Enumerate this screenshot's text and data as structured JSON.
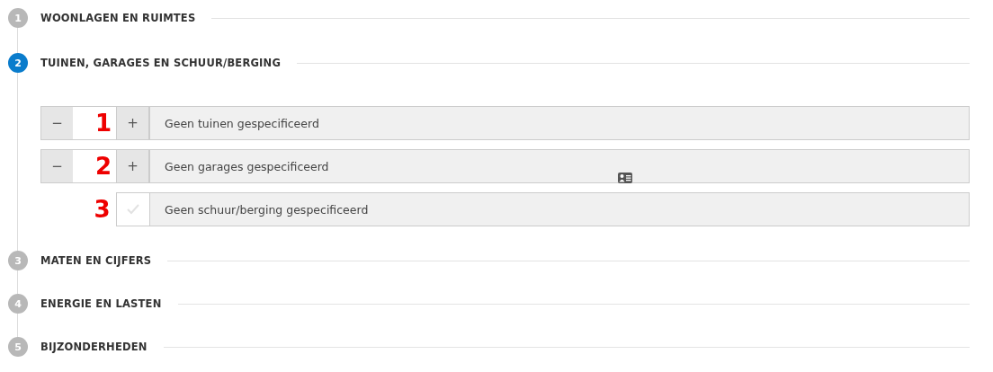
{
  "steps": [
    {
      "number": "1",
      "title": "WOONLAGEN EN RUIMTES",
      "selected": false
    },
    {
      "number": "2",
      "title": "TUINEN, GARAGES EN SCHUUR/BERGING",
      "selected": true,
      "items": [
        {
          "kind": "counter",
          "minus": "−",
          "annotation": "1",
          "plus": "+",
          "label": "Geen tuinen gespecificeerd"
        },
        {
          "kind": "counter",
          "minus": "−",
          "annotation": "2",
          "plus": "+",
          "label": "Geen garages gespecificeerd"
        },
        {
          "kind": "checkbox",
          "annotation": "3",
          "checked": false,
          "label": "Geen schuur/berging gespecificeerd"
        }
      ]
    },
    {
      "number": "3",
      "title": "MATEN EN CIJFERS",
      "selected": false
    },
    {
      "number": "4",
      "title": "ENERGIE EN LASTEN",
      "selected": false
    },
    {
      "number": "5",
      "title": "BIJZONDERHEDEN",
      "selected": false
    }
  ]
}
